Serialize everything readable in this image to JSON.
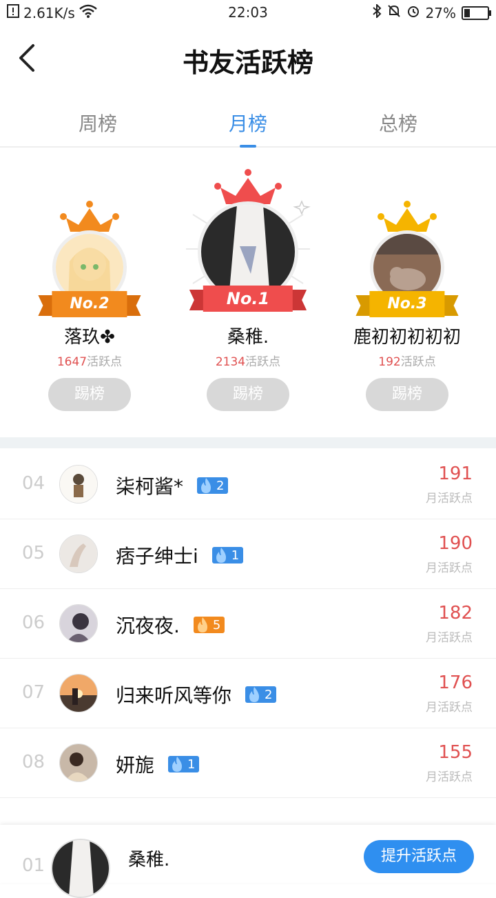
{
  "status": {
    "speed": "2.61K/s",
    "time": "22:03",
    "battery": "27%"
  },
  "header": {
    "back_icon": "chevron-left-icon",
    "title": "书友活跃榜"
  },
  "tabs": [
    {
      "label": "周榜",
      "active": false
    },
    {
      "label": "月榜",
      "active": true
    },
    {
      "label": "总榜",
      "active": false
    }
  ],
  "podium": {
    "points_suffix": "活跃点",
    "button_label": "踢榜",
    "first": {
      "rank_label": "No.1",
      "name": "桑稚.",
      "points": "2134"
    },
    "second": {
      "rank_label": "No.2",
      "name": "落玖✤",
      "points": "1647"
    },
    "third": {
      "rank_label": "No.3",
      "name": "鹿初初初初初",
      "points": "192"
    }
  },
  "list": {
    "score_label": "月活跃点",
    "rows": [
      {
        "rank": "04",
        "name": "柒柯酱*",
        "level": "2",
        "score": "191"
      },
      {
        "rank": "05",
        "name": "痞子绅士i",
        "level": "1",
        "score": "190"
      },
      {
        "rank": "06",
        "name": "沉夜夜.",
        "level": "5",
        "score": "182"
      },
      {
        "rank": "07",
        "name": "归来听风等你",
        "level": "2",
        "score": "176"
      },
      {
        "rank": "08",
        "name": "妍旎",
        "level": "1",
        "score": "155"
      }
    ]
  },
  "me": {
    "rank": "01",
    "name": "桑稚.",
    "button_label": "提升活跃点"
  },
  "colors": {
    "accent": "#3a8ee6",
    "score": "#e05050",
    "gold": "#f5b400",
    "silver_orange": "#f28a1e",
    "red": "#ef4d4d"
  }
}
